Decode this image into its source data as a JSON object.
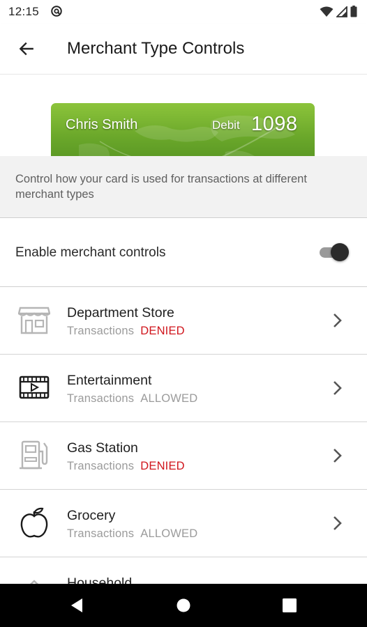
{
  "status_bar": {
    "time": "12:15"
  },
  "header": {
    "title": "Merchant Type Controls"
  },
  "card": {
    "holder_name": "Chris Smith",
    "type": "Debit",
    "last4": "1098"
  },
  "description": "Control how your card is used for transactions at different merchant types",
  "enable_controls": {
    "label": "Enable merchant controls",
    "enabled": true
  },
  "merchants": [
    {
      "name": "Department Store",
      "label": "Transactions",
      "status": "DENIED",
      "icon": "storefront-icon"
    },
    {
      "name": "Entertainment",
      "label": "Transactions",
      "status": "ALLOWED",
      "icon": "film-icon"
    },
    {
      "name": "Gas Station",
      "label": "Transactions",
      "status": "DENIED",
      "icon": "gas-pump-icon"
    },
    {
      "name": "Grocery",
      "label": "Transactions",
      "status": "ALLOWED",
      "icon": "apple-icon"
    },
    {
      "name": "Household",
      "label": "",
      "status": "",
      "icon": "house-icon"
    }
  ],
  "colors": {
    "denied": "#d0151c",
    "allowed": "#9b9b9b",
    "card_green": "#6aa72a"
  }
}
